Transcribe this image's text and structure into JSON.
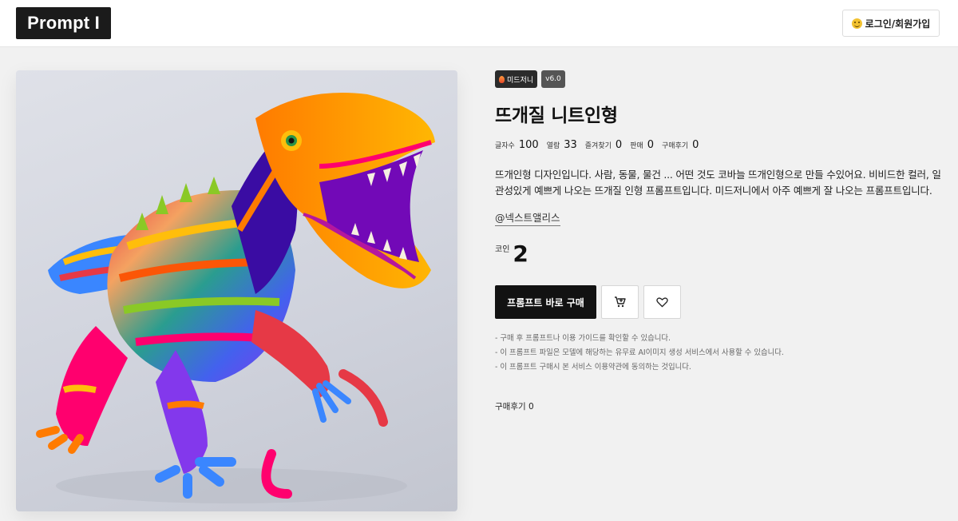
{
  "header": {
    "logo": "Prompt I",
    "login_label": "로그인/회원가입",
    "login_icon": "smile-emoji-icon"
  },
  "product": {
    "image_alt": "crochet-dinosaur-image",
    "badges": {
      "model": "미드저니",
      "model_icon": "flame-icon",
      "version": "v6.0"
    },
    "title": "뜨개질 니트인형",
    "stats": [
      {
        "label": "글자수",
        "value": "100"
      },
      {
        "label": "열람",
        "value": "33"
      },
      {
        "label": "즐겨찾기",
        "value": "0"
      },
      {
        "label": "판매",
        "value": "0"
      },
      {
        "label": "구매후기",
        "value": "0"
      }
    ],
    "description_line1": "뜨개인형 디자인입니다. 사람, 동물, 물건 ... 어떤 것도 코바늘 뜨개인형으로 만들 수있어요. 비비드한 컬러, 일",
    "description_line2": "관성있게 예쁘게 나오는 뜨개질 인형 프롬프트입니다. 미드저니에서 아주 예쁘게 잘 나오는 프롬프트입니다.",
    "author": "@넥스트앨리스",
    "price_label": "코인",
    "price_value": "2",
    "buy_label": "프롬프트 바로 구매",
    "cart_icon": "cart-icon",
    "heart_icon": "heart-icon",
    "notes": [
      "- 구매 후 프롬프트나 이용 가이드를 확인할 수 있습니다.",
      "- 이 프롬프트 파일은 모델에 해당하는 유무료 AI이미지 생성 서비스에서 사용할 수 있습니다.",
      "- 이 프롬프트 구매시 본 서비스 이용약관에 동의하는 것입니다."
    ],
    "reviews_label": "구매후기 0"
  },
  "colors": {
    "accent": "#121212",
    "background": "#f1f1f1"
  }
}
